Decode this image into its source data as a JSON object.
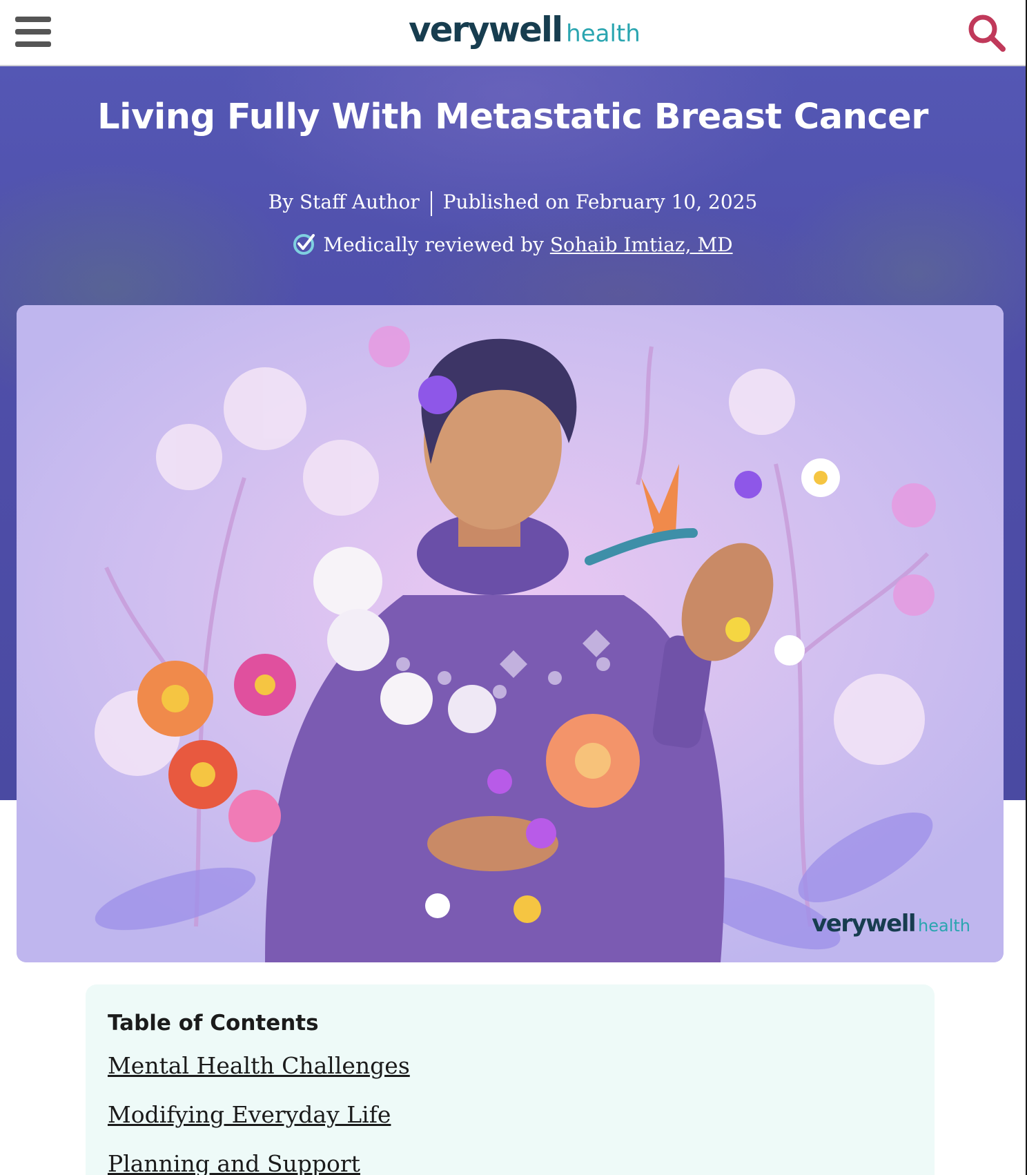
{
  "header": {
    "logo_primary": "verywell",
    "logo_secondary": "health",
    "menu_icon": "hamburger-menu-icon",
    "search_icon": "search-icon",
    "search_color": "#c0395a"
  },
  "article": {
    "title": "Living Fully With Metastatic Breast Cancer",
    "author": "By Staff Author",
    "published": "Published on February 10, 2025",
    "reviewed_prefix": "Medically reviewed by",
    "reviewer": "Sohaib Imtiaz, MD",
    "hero_color": "#4f4ea9"
  },
  "hero_image": {
    "watermark_primary": "verywell",
    "watermark_secondary": "health"
  },
  "toc": {
    "heading": "Table of Contents",
    "items": [
      "Mental Health Challenges",
      "Modifying Everyday Life",
      "Planning and Support"
    ]
  }
}
